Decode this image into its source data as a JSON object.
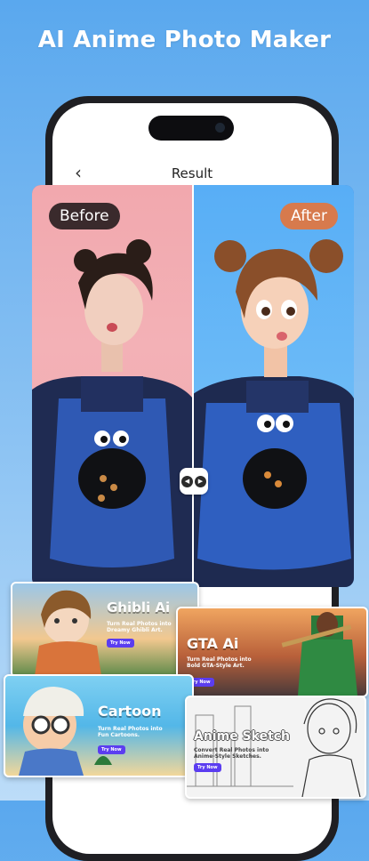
{
  "headline": "AI Anime Photo Maker",
  "nav": {
    "back_glyph": "‹",
    "title": "Result"
  },
  "compare": {
    "before_label": "Before",
    "after_label": "After",
    "handle_icons": [
      "◀",
      "▶"
    ]
  },
  "cards": {
    "ghibli": {
      "title": "Ghibli Ai",
      "desc": "Turn Real Photos into\nDreamy Ghibli Art.",
      "button": "Try Now"
    },
    "gta": {
      "title": "GTA Ai",
      "desc": "Turn Real Photos into\nBold GTA-Style Art.",
      "button": "Try Now"
    },
    "cartoon": {
      "title": "Cartoon",
      "desc": "Turn Real Photos into\nFun Cartoons.",
      "button": "Try Now"
    },
    "sketch": {
      "title": "Anime Sketch",
      "desc": "Convert Real Photos into\nAnime-Style Sketches.",
      "button": "Try Now"
    }
  },
  "colors": {
    "before_bg": "#f2a8ae",
    "after_bg": "#5baef6",
    "before_pill": "#3a2a2c",
    "after_pill": "#d77a4d",
    "try_button": "#5b3df0"
  }
}
